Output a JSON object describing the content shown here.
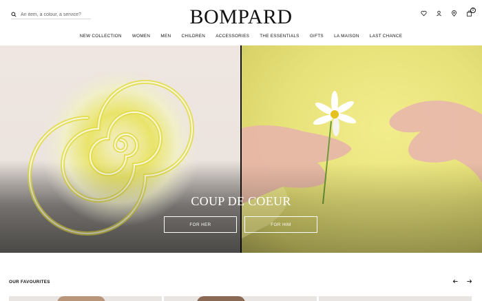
{
  "header": {
    "search": {
      "placeholder": "An item, a colour, a service?",
      "value": ""
    },
    "logo": "BOMPARD",
    "icons": [
      "heart-icon",
      "user-icon",
      "location-pin-icon",
      "bag-icon"
    ],
    "cart_count": "0"
  },
  "nav": {
    "items": [
      {
        "label": "NEW COLLECTION"
      },
      {
        "label": "WOMEN"
      },
      {
        "label": "MEN"
      },
      {
        "label": "CHILDREN"
      },
      {
        "label": "ACCESSORIES"
      },
      {
        "label": "THE ESSENTIALS"
      },
      {
        "label": "GIFTS"
      },
      {
        "label": "LA MAISON"
      },
      {
        "label": "LAST CHANCE"
      }
    ]
  },
  "hero": {
    "title": "COUP DE COEUR",
    "cta_her": "FOR HER",
    "cta_him": "FOR HIM"
  },
  "favourites": {
    "title": "OUR FAVOURITES"
  },
  "colors": {
    "accent": "#111111",
    "hero_left_bg": "#efe6e1",
    "hero_right_bg": "#ece57f"
  }
}
